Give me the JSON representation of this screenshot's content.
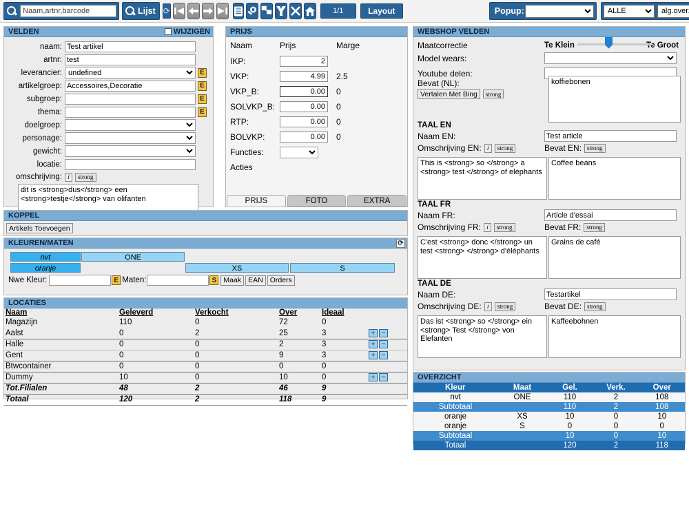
{
  "toolbar": {
    "search_placeholder": "Naam,artnr,barcode",
    "search_value": "",
    "lijst_label": "Lijst",
    "refresh_icon": "refresh-icon",
    "nav": [
      {
        "name": "first-record-button",
        "glyph": "first"
      },
      {
        "name": "previous-record-button",
        "glyph": "prev"
      },
      {
        "name": "next-record-button",
        "glyph": "next"
      },
      {
        "name": "last-record-button",
        "glyph": "last"
      }
    ],
    "actions": [
      {
        "name": "list-view-button",
        "glyph": "list"
      },
      {
        "name": "find-button",
        "glyph": "magnifier"
      },
      {
        "name": "duplicate-record-button",
        "glyph": "duplicate"
      },
      {
        "name": "sort-button",
        "glyph": "sort-down"
      },
      {
        "name": "delete-button",
        "glyph": "cross"
      },
      {
        "name": "home-button",
        "glyph": "home"
      }
    ],
    "page_count": "1/1",
    "layout_label": "Layout",
    "popup_label": "Popup:",
    "popup_value": "",
    "filter_value": "ALLE",
    "layout_select_value": "alg.overzicht"
  },
  "velden": {
    "title": "VELDEN",
    "wijzigen_label": "WIJZIGEN",
    "wijzigen_checked": false,
    "rows": [
      {
        "label": "naam:",
        "value": "Test artikel",
        "type": "text",
        "edit": false
      },
      {
        "label": "artnr:",
        "value": "test",
        "type": "text",
        "edit": false
      },
      {
        "label": "leverancier:",
        "value": "undefined",
        "type": "select",
        "edit": true
      },
      {
        "label": "artikelgroep:",
        "value": "Accessoires,Decoratie",
        "type": "text",
        "edit": true
      },
      {
        "label": "subgroep:",
        "value": "",
        "type": "text",
        "edit": true
      },
      {
        "label": "thema:",
        "value": "",
        "type": "text",
        "edit": true
      },
      {
        "label": "doelgroep:",
        "value": "",
        "type": "select",
        "edit": false
      },
      {
        "label": "personage:",
        "value": "",
        "type": "select",
        "edit": false
      },
      {
        "label": "gewicht:",
        "value": "",
        "type": "select",
        "edit": false
      },
      {
        "label": "locatie:",
        "value": "",
        "type": "text",
        "edit": false
      }
    ],
    "omschrijving_label": "omschrijving:",
    "info_btn": "i",
    "strong_btn": "strong",
    "omschrijving_value": "dit is <strong>dus</strong> een\n<strong>testje</strong> van olifanten"
  },
  "prijs": {
    "title": "PRIJS",
    "col_naam": "Naam",
    "col_prijs": "Prijs",
    "col_marge": "Marge",
    "rows": [
      {
        "label": "IKP:",
        "price": "2",
        "marge": ""
      },
      {
        "label": "VKP:",
        "price": "4.99",
        "marge": "2.5"
      },
      {
        "label": "VKP_B:",
        "price": "0.00",
        "marge": "0"
      },
      {
        "label": "SOLVKP_B:",
        "price": "0.00",
        "marge": "0"
      },
      {
        "label": "RTP:",
        "price": "0.00",
        "marge": "0"
      },
      {
        "label": "BOLVKP:",
        "price": "0.00",
        "marge": "0"
      }
    ],
    "functies_label": "Functies:",
    "functies_value": "",
    "acties_label": "Acties",
    "tabs": [
      {
        "label": "PRIJS",
        "active": true
      },
      {
        "label": "FOTO",
        "active": false
      },
      {
        "label": "EXTRA",
        "active": false
      }
    ]
  },
  "koppel": {
    "title": "KOPPEL",
    "add_button": "Artikels Toevoegen"
  },
  "kleuren_maten": {
    "title": "KLEUREN/MATEN",
    "refresh_icon": "refresh-icon",
    "grid": [
      {
        "color": "nvt",
        "sizes": [
          {
            "label": "ONE",
            "col": 0,
            "span": 2
          }
        ]
      },
      {
        "color": "oranje",
        "sizes": [
          {
            "label": "XS",
            "col": 2,
            "span": 1
          },
          {
            "label": "S",
            "col": 3,
            "span": 1
          }
        ]
      }
    ],
    "nwe_kleur_label": "Nwe Kleur:",
    "nwe_kleur_value": "",
    "kleur_edit_btn": "E",
    "maten_label": "Maten:",
    "maten_value": "",
    "maten_edit_btn": "S",
    "maak_btn": "Maak",
    "ean_btn": "EAN",
    "orders_btn": "Orders"
  },
  "locaties": {
    "title": "LOCATIES",
    "columns": [
      "Naam",
      "Geleverd",
      "Verkocht",
      "Over",
      "Ideaal"
    ],
    "rows": [
      {
        "naam": "Magazijn",
        "geleverd": "110",
        "verkocht": "0",
        "over": "72",
        "ideaal": "0",
        "buttons": false,
        "style": "plain",
        "divider": "none"
      },
      {
        "naam": "Aalst",
        "geleverd": "0",
        "verkocht": "2",
        "over": "25",
        "ideaal": "3",
        "buttons": true,
        "style": "plain",
        "divider": "thick"
      },
      {
        "naam": "Halle",
        "geleverd": "0",
        "verkocht": "0",
        "over": "2",
        "ideaal": "3",
        "buttons": true,
        "style": "plain",
        "divider": "thin"
      },
      {
        "naam": "Gent",
        "geleverd": "0",
        "verkocht": "0",
        "over": "9",
        "ideaal": "3",
        "buttons": true,
        "style": "plain",
        "divider": "thick"
      },
      {
        "naam": "Btwcontainer",
        "geleverd": "0",
        "verkocht": "0",
        "over": "0",
        "ideaal": "0",
        "buttons": false,
        "style": "plain",
        "divider": "thick"
      },
      {
        "naam": "Dummy",
        "geleverd": "10",
        "verkocht": "0",
        "over": "10",
        "ideaal": "0",
        "buttons": true,
        "style": "plain",
        "divider": "thick"
      },
      {
        "naam": "Tot.Filialen",
        "geleverd": "48",
        "verkocht": "2",
        "over": "46",
        "ideaal": "9",
        "buttons": false,
        "style": "italic",
        "divider": "thick"
      },
      {
        "naam": "Totaal",
        "geleverd": "120",
        "verkocht": "2",
        "over": "118",
        "ideaal": "9",
        "buttons": false,
        "style": "italic",
        "divider": "thick"
      }
    ],
    "plus_btn": "+",
    "minus_btn": "−"
  },
  "webshop": {
    "title": "WEBSHOP VELDEN",
    "maatcorrectie_label": "Maatcorrectie",
    "slider_min_label": "Te Klein",
    "slider_max_label": "Te Groot",
    "slider_value": 50,
    "model_wears_label": "Model wears:",
    "model_wears_value": "",
    "youtube_label": "Youtube delen:",
    "youtube_value": "",
    "bevat_nl_label": "Bevat (NL):",
    "translate_btn": "Vertalen Met Bing",
    "strong_btn": "strong",
    "bevat_nl_value": "koffiebonen"
  },
  "taal_en": {
    "title": "TAAL EN",
    "naam_label": "Naam EN:",
    "naam_value": "Test article",
    "omschrijving_label": "Omschrijving EN:",
    "info_btn": "i",
    "strong_btn": "strong",
    "omschrijving_value": "This is <strong> so </strong> a <strong> test </strong> of elephants",
    "bevat_label": "Bevat EN:",
    "bevat_strong_btn": "strong",
    "bevat_value": "Coffee beans"
  },
  "taal_fr": {
    "title": "TAAL FR",
    "naam_label": "Naam FR:",
    "naam_value": "Article d'essai",
    "omschrijving_label": "Omschrijving FR:",
    "info_btn": "i",
    "strong_btn": "strong",
    "omschrijving_value": "C'est <strong> donc </strong> un test <strong> </strong> d'éléphants",
    "bevat_label": "Bevat FR:",
    "bevat_strong_btn": "strong",
    "bevat_value": "Grains de café"
  },
  "taal_de": {
    "title": "TAAL DE",
    "naam_label": "Naam DE:",
    "naam_value": "Testartikel",
    "omschrijving_label": "Omschrijving DE:",
    "info_btn": "i",
    "strong_btn": "strong",
    "omschrijving_value": "Das ist <strong> so </strong> ein <strong> Test </strong> von Elefanten",
    "bevat_label": "Bevat DE:",
    "bevat_strong_btn": "strong",
    "bevat_value": "Kaffeebohnen"
  },
  "overzicht": {
    "title": "OVERZICHT",
    "columns": [
      "Kleur",
      "Maat",
      "Gel.",
      "Verk.",
      "Over"
    ],
    "rows": [
      {
        "kleur": "nvt",
        "maat": "ONE",
        "gel": "110",
        "verk": "2",
        "over": "108",
        "type": "data"
      },
      {
        "kleur": "Subtotaal",
        "maat": "",
        "gel": "110",
        "verk": "2",
        "over": "108",
        "type": "sub"
      },
      {
        "kleur": "oranje",
        "maat": "XS",
        "gel": "10",
        "verk": "0",
        "over": "10",
        "type": "data"
      },
      {
        "kleur": "oranje",
        "maat": "S",
        "gel": "0",
        "verk": "0",
        "over": "0",
        "type": "data"
      },
      {
        "kleur": "Subtotaal",
        "maat": "",
        "gel": "10",
        "verk": "0",
        "over": "10",
        "type": "sub"
      },
      {
        "kleur": "Totaal",
        "maat": "",
        "gel": "120",
        "verk": "2",
        "over": "118",
        "type": "tot"
      }
    ]
  },
  "colors": {
    "toolbar_blue": "#2a6496",
    "panel_header": "#7aacd4",
    "panel_bg": "#ececec",
    "chip_color": "#35b0f0",
    "chip_size": "#96d4f5",
    "edit_yellow": "#f7c544",
    "table_header_blue": "#1f6cb0",
    "subtotal_blue": "#3f8dcc"
  }
}
